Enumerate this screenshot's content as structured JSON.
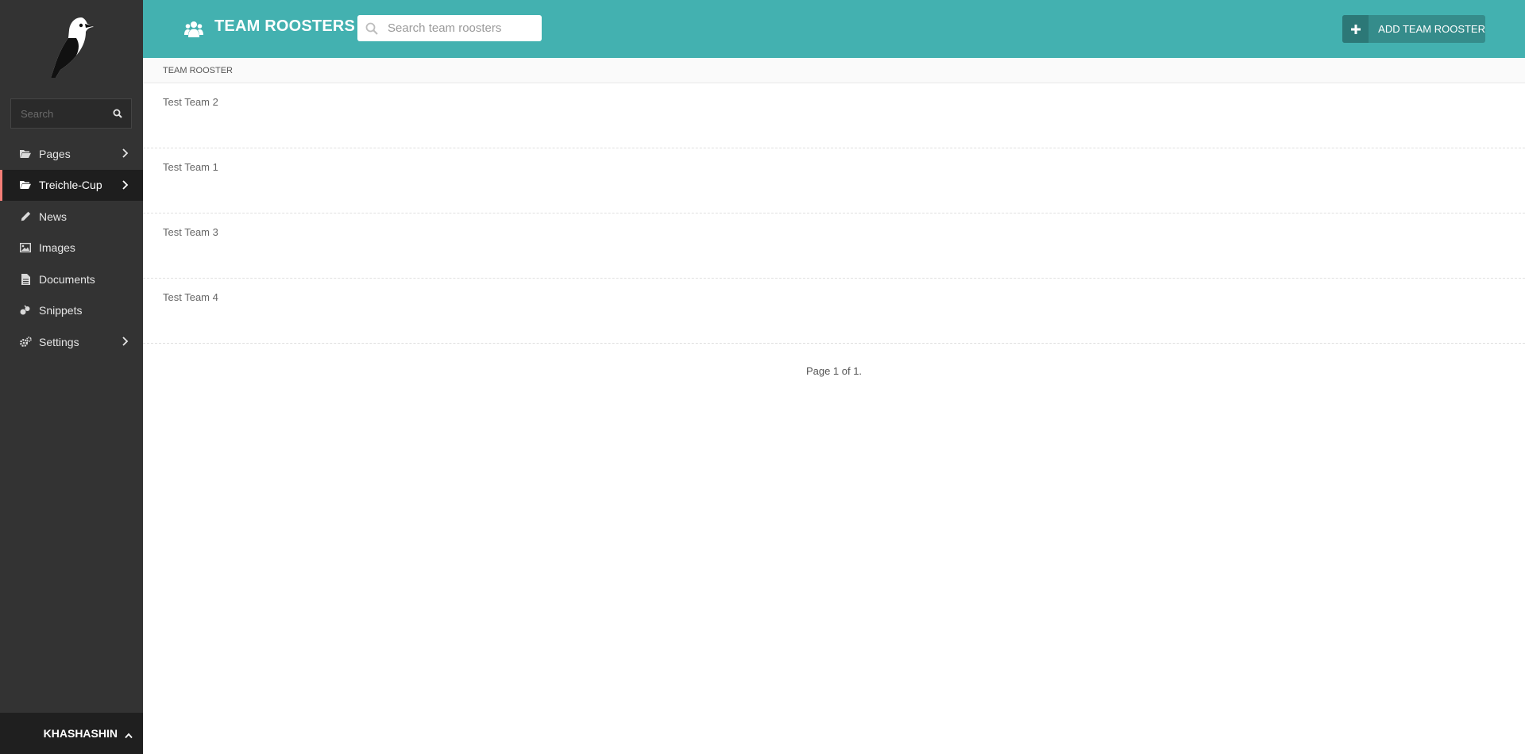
{
  "sidebar": {
    "search": {
      "placeholder": "Search"
    },
    "menu": [
      {
        "label": "Pages",
        "icon": "folder-open-icon",
        "has_submenu": true,
        "active": false
      },
      {
        "label": "Treichle-Cup",
        "icon": "folder-open-icon",
        "has_submenu": true,
        "active": true
      },
      {
        "label": "News",
        "icon": "pencil-icon",
        "has_submenu": false,
        "active": false
      },
      {
        "label": "Images",
        "icon": "image-icon",
        "has_submenu": false,
        "active": false
      },
      {
        "label": "Documents",
        "icon": "document-icon",
        "has_submenu": false,
        "active": false
      },
      {
        "label": "Snippets",
        "icon": "snippet-icon",
        "has_submenu": false,
        "active": false
      },
      {
        "label": "Settings",
        "icon": "cogs-icon",
        "has_submenu": true,
        "active": false
      }
    ],
    "account": {
      "username": "KHASHASHIN"
    }
  },
  "header": {
    "title": "TEAM ROOSTERS",
    "search_placeholder": "Search team roosters",
    "add_button_label": "ADD TEAM ROOSTER"
  },
  "table": {
    "column_header": "TEAM ROOSTER",
    "rows": [
      "Test Team 2",
      "Test Team 1",
      "Test Team 3",
      "Test Team 4"
    ]
  },
  "pagination": {
    "text": "Page 1 of 1."
  },
  "colors": {
    "header_bg": "#43b1b0",
    "sidebar_bg": "#333333",
    "active_indicator": "#f37e77",
    "add_button_bg": "#358c8b"
  }
}
